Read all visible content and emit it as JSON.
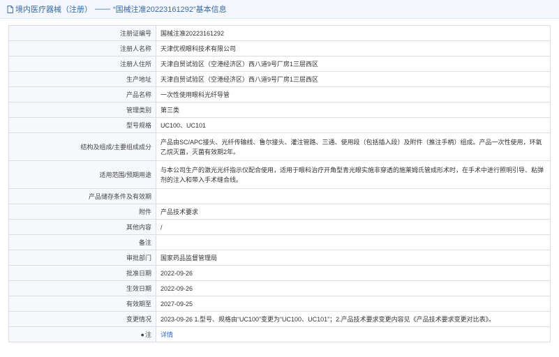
{
  "header": {
    "section": "境内医疗器械（注册）",
    "dash": "——",
    "title": "“国械注准20223161292”基本信息"
  },
  "rows": [
    {
      "label": "注册证编号",
      "value": "国械注准20223161292"
    },
    {
      "label": "注册人名称",
      "value": "天津优视眼科技术有限公司"
    },
    {
      "label": "注册人住所",
      "value": "天津自贸试验区（空港经济区）西八道9号厂房1三层西区"
    },
    {
      "label": "生产地址",
      "value": "天津自贸试验区（空港经济区）西八道9号厂房1三层西区"
    },
    {
      "label": "产品名称",
      "value": "一次性使用眼科光纤导管"
    },
    {
      "label": "管理类别",
      "value": "第三类"
    },
    {
      "label": "型号规格",
      "value": "UC100、UC101"
    },
    {
      "label": "结构及组成/主要组成成分",
      "value": "产品由SC/APC接头、光纤传输线、鲁尔接头、灌注管路、三通、使用段（包括插入段）及附件（推注手柄）组成。产品一次性使用，环氧乙烷灭菌，灭菌有效期2年。"
    },
    {
      "label": "适用范围/预期用途",
      "value": "与本公司生产的激光光纤指示仪配合使用，适用于眼科治疗开角型青光眼实施非穿透的施莱姆氏管成形术时，在手术中进行照明引导、粘弹剂的注入和带入手术缝合线。"
    },
    {
      "label": "产品储存条件及有效期",
      "value": ""
    },
    {
      "label": "附件",
      "value": "产品技术要求"
    },
    {
      "label": "其他内容",
      "value": "/"
    },
    {
      "label": "备注",
      "value": ""
    },
    {
      "label": "审批部门",
      "value": "国家药品监督管理局"
    },
    {
      "label": "批准日期",
      "value": "2022-09-26"
    },
    {
      "label": "生效日期",
      "value": "2022-09-26"
    },
    {
      "label": "有效期至",
      "value": "2027-09-25"
    },
    {
      "label": "变更情况",
      "value": "2023-09-26 1.型号、规格由“UC100”变更为“UC100、UC101”；2.产品技术要求变更内容见《产品技术要求变更对比表》。"
    },
    {
      "label": "注",
      "value": "详情"
    }
  ]
}
